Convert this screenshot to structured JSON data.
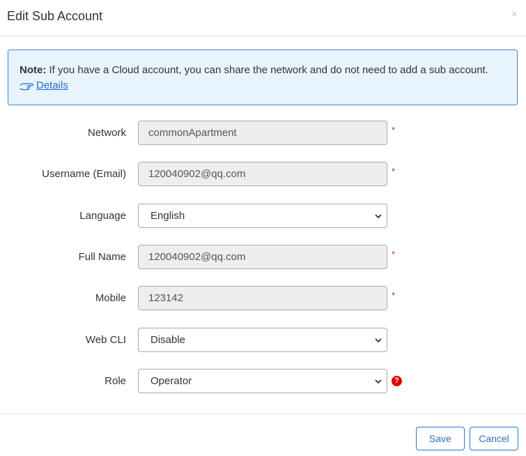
{
  "dialog": {
    "title": "Edit Sub Account",
    "close_symbol": "×"
  },
  "note": {
    "label": "Note:",
    "text": " If you have a Cloud account, you can share the network and do not need to add a sub account.",
    "details_label": "Details",
    "details_icon": "pointing-hand-icon"
  },
  "form": {
    "network": {
      "label": "Network",
      "value": "commonApartment",
      "required_mark": "*"
    },
    "username": {
      "label": "Username (Email)",
      "value": "120040902@qq.com",
      "required_mark": "*"
    },
    "language": {
      "label": "Language",
      "value": "English"
    },
    "full_name": {
      "label": "Full Name",
      "value": "120040902@qq.com",
      "required_mark": "*"
    },
    "mobile": {
      "label": "Mobile",
      "value": "123142",
      "required_mark": "*"
    },
    "web_cli": {
      "label": "Web CLI",
      "value": "Disable"
    },
    "role": {
      "label": "Role",
      "value": "Operator",
      "help_symbol": "?"
    }
  },
  "footer": {
    "save_label": "Save",
    "cancel_label": "Cancel"
  },
  "colors": {
    "accent": "#2a72c9",
    "note_bg": "#e8f4fd",
    "required": "#e02020",
    "help": "#e00000"
  }
}
